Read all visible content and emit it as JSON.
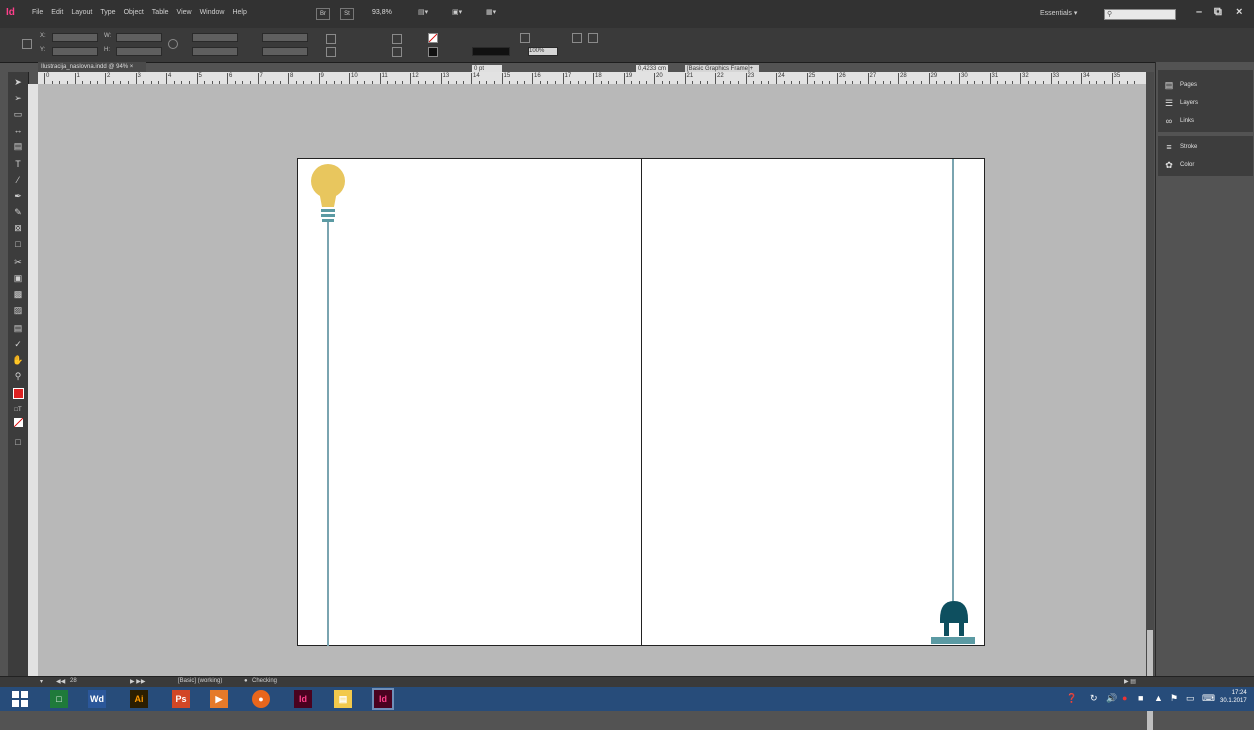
{
  "app": {
    "logo": "Id"
  },
  "menu": [
    "File",
    "Edit",
    "Layout",
    "Type",
    "Object",
    "Table",
    "View",
    "Window",
    "Help"
  ],
  "zoom": "93,8%",
  "workspace": "Essentials",
  "control": {
    "x_label": "X:",
    "y_label": "Y:",
    "w_label": "W:",
    "h_label": "H:",
    "stroke_weight": "0 pt",
    "opacity": "100%",
    "measure": "0,4233 cm",
    "object_style": "[Basic Graphics Frame]+"
  },
  "document_tab": "Ilustracija_naslovna.indd @ 94%",
  "ruler_numbers": [
    "0",
    "1",
    "2",
    "3",
    "4",
    "5",
    "6",
    "7",
    "8",
    "9",
    "10",
    "11",
    "12",
    "13",
    "14",
    "15",
    "16",
    "17",
    "18",
    "19",
    "20",
    "21",
    "22",
    "23",
    "24",
    "25",
    "26",
    "27",
    "28",
    "29",
    "30",
    "31",
    "32",
    "33",
    "34",
    "35",
    "36"
  ],
  "status": {
    "page": "28",
    "style": "[Basic] (working)",
    "preflight": "Checking"
  },
  "panels": {
    "group1": [
      "Pages",
      "Layers",
      "Links"
    ],
    "group2": [
      "Stroke",
      "Color"
    ]
  },
  "taskbar": {
    "apps": [
      "Wd",
      "Ai",
      "Ps",
      "Id",
      "Id"
    ],
    "time": "17:24",
    "date": "30.1.2017"
  },
  "colors": {
    "bulb": "#e8c65e",
    "bulb_base": "#5b9aa3",
    "plug": "#0e4f5f",
    "wire": "#7aa4b0"
  }
}
